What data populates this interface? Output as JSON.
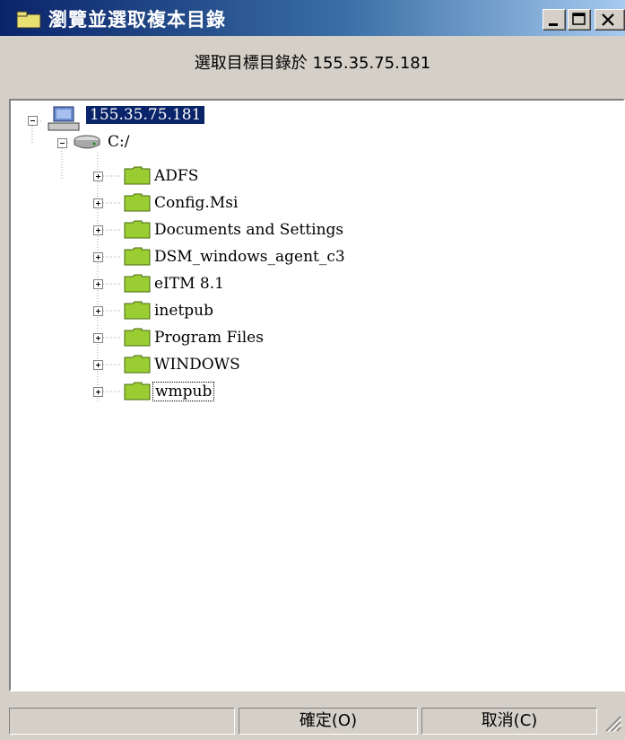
{
  "window": {
    "title": "瀏覽並選取複本目錄",
    "subtitle": "選取目標目錄於 155.35.75.181"
  },
  "tree": {
    "root": {
      "label": "155.35.75.181",
      "icon": "computer-icon",
      "expanded": true,
      "selected": true
    },
    "drive": {
      "label": "C:/",
      "icon": "drive-icon",
      "expanded": true
    },
    "folders": [
      "ADFS",
      "Config.Msi",
      "Documents and Settings",
      "DSM_windows_agent_c3",
      "eITM 8.1",
      "inetpub",
      "Program Files",
      "WINDOWS",
      "wmpub"
    ],
    "focused_folder": "wmpub"
  },
  "buttons": {
    "ok_label": "確定(O)",
    "cancel_label": "取消(C)"
  },
  "colors": {
    "title_start": "#0a246a",
    "title_end": "#a6caf0",
    "selection": "#0a246a",
    "folder": "#9acd32",
    "chrome": "#d4d0c8"
  }
}
